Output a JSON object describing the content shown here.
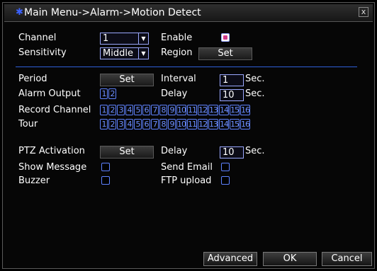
{
  "window": {
    "title": "Main Menu->Alarm->Motion Detect",
    "close_glyph": "x",
    "brand_icon": "dvr-logo-icon"
  },
  "channel": {
    "label": "Channel",
    "value": "1"
  },
  "enable": {
    "label": "Enable",
    "checked": true
  },
  "sensitivity": {
    "label": "Sensitivity",
    "value": "Middle"
  },
  "region": {
    "label": "Region",
    "button": "Set"
  },
  "period": {
    "label": "Period",
    "button": "Set"
  },
  "interval": {
    "label": "Interval",
    "value": "1",
    "unit": "Sec."
  },
  "alarm_output": {
    "label": "Alarm Output",
    "channels": [
      "1",
      "2"
    ]
  },
  "delay1": {
    "label": "Delay",
    "value": "10",
    "unit": "Sec."
  },
  "record_channel": {
    "label": "Record Channel",
    "channels": [
      "1",
      "2",
      "3",
      "4",
      "5",
      "6",
      "7",
      "8",
      "9",
      "10",
      "11",
      "12",
      "13",
      "14",
      "15",
      "16"
    ]
  },
  "tour": {
    "label": "Tour",
    "channels": [
      "1",
      "2",
      "3",
      "4",
      "5",
      "6",
      "7",
      "8",
      "9",
      "10",
      "11",
      "12",
      "13",
      "14",
      "15",
      "16"
    ]
  },
  "ptz": {
    "label": "PTZ Activation",
    "button": "Set"
  },
  "delay2": {
    "label": "Delay",
    "value": "10",
    "unit": "Sec."
  },
  "show_message": {
    "label": "Show Message",
    "checked": false
  },
  "send_email": {
    "label": "Send Email",
    "checked": false
  },
  "buzzer": {
    "label": "Buzzer",
    "checked": false
  },
  "ftp_upload": {
    "label": "FTP upload",
    "checked": false
  },
  "footer": {
    "advanced": "Advanced",
    "ok": "OK",
    "cancel": "Cancel"
  },
  "colors": {
    "accent": "#5e82ff",
    "separator": "#2f5fd8",
    "check": "#d03a8a"
  }
}
